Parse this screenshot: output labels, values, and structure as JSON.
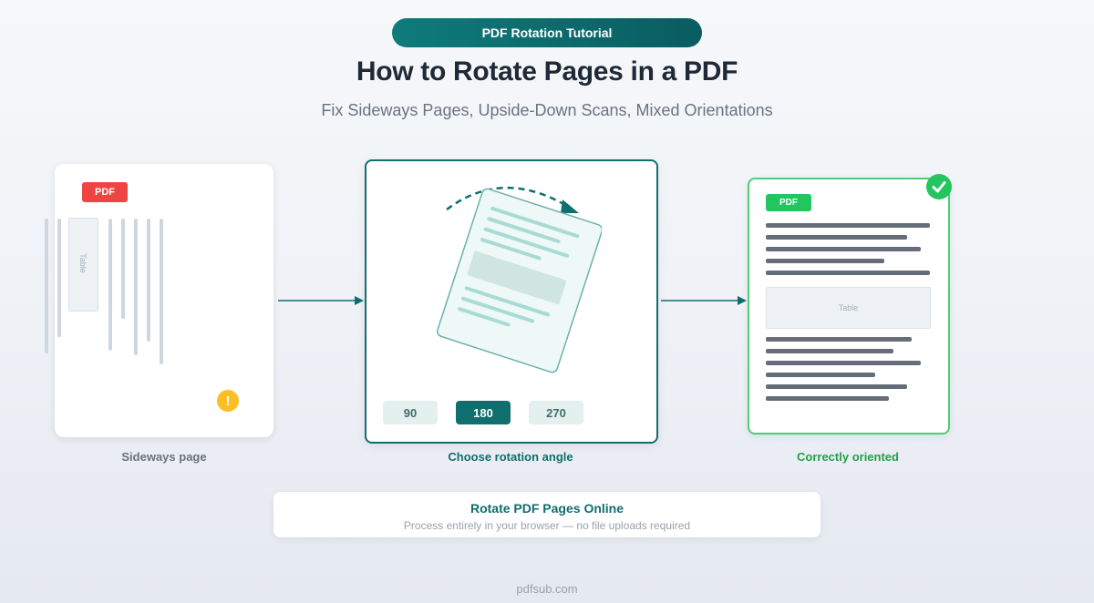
{
  "header": {
    "badge": "PDF Rotation Tutorial",
    "title": "How to Rotate Pages in a PDF",
    "subtitle": "Fix Sideways Pages, Upside-Down Scans, Mixed Orientations"
  },
  "steps": {
    "before": {
      "badge": "PDF",
      "table_label": "Table",
      "caption": "Sideways page",
      "warning_glyph": "!"
    },
    "rotate": {
      "angles": [
        "90",
        "180",
        "270"
      ],
      "selected_angle": "180",
      "caption": "Choose rotation angle"
    },
    "after": {
      "badge": "PDF",
      "table_label": "Table",
      "caption": "Correctly oriented"
    }
  },
  "info": {
    "title": "Rotate PDF Pages Online",
    "subtitle": "Process entirely in your browser — no file uploads required"
  },
  "footer": {
    "site": "pdfsub.com"
  },
  "colors": {
    "teal": "#0f6e6e",
    "green": "#22c55e",
    "red": "#ef4444",
    "warning": "#fbbf24",
    "dark_text": "#1f2937",
    "muted_text": "#6b7280"
  },
  "icons": [
    "warning-icon",
    "rotate-arrow-icon",
    "check-circle-icon",
    "arrow-right-icon"
  ]
}
